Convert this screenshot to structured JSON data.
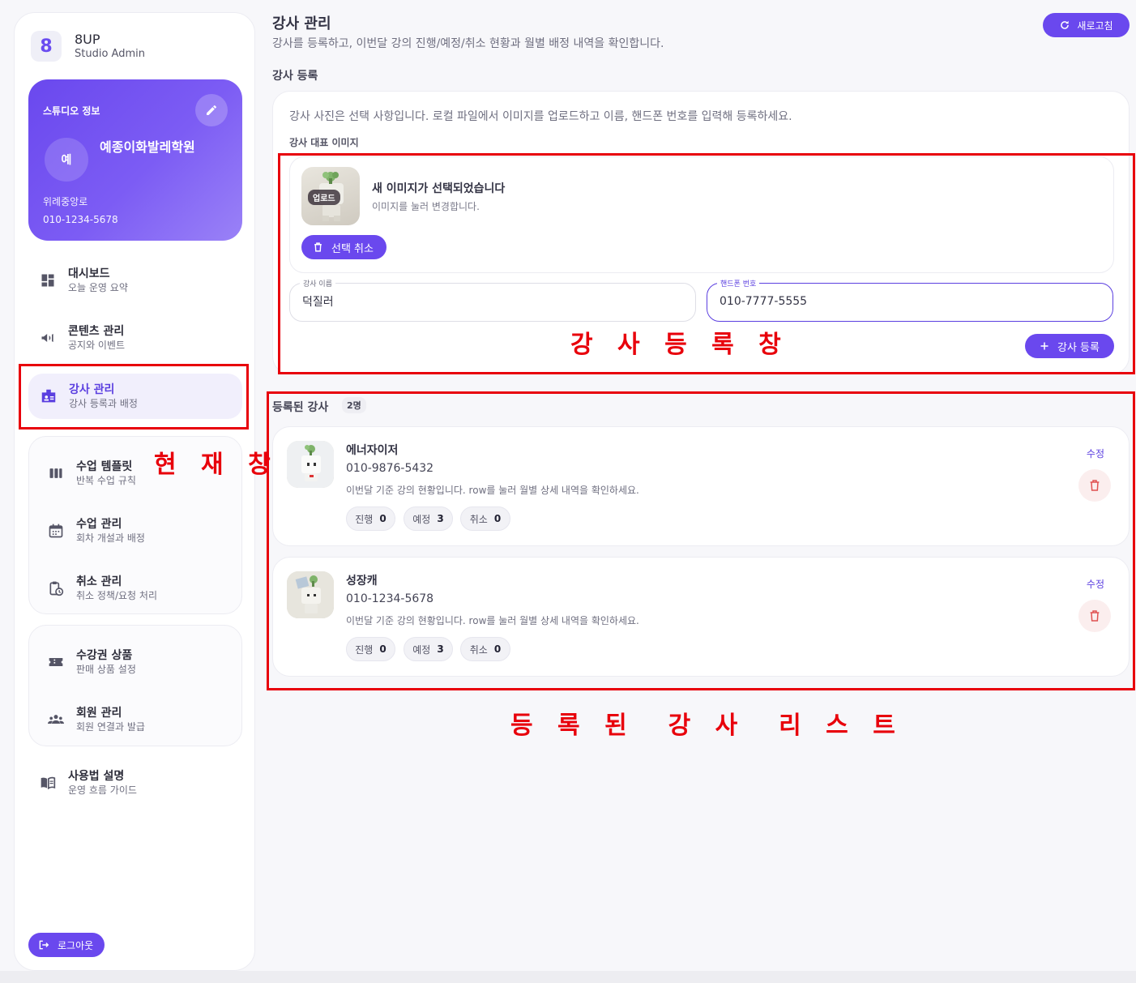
{
  "brand": {
    "name": "8UP",
    "subtitle": "Studio Admin",
    "logo_text": "8"
  },
  "studio": {
    "section_title": "스튜디오 정보",
    "avatar_initial": "예",
    "name": "예종이화발레학원",
    "address": "위례중앙로",
    "phone": "010-1234-5678"
  },
  "nav": {
    "dashboard": {
      "label": "대시보드",
      "sub": "오늘 운영 요약"
    },
    "content": {
      "label": "콘텐츠 관리",
      "sub": "공지와 이벤트"
    },
    "instructors": {
      "label": "강사 관리",
      "sub": "강사 등록과 배정"
    },
    "templates": {
      "label": "수업 템플릿",
      "sub": "반복 수업 규칙"
    },
    "classes": {
      "label": "수업 관리",
      "sub": "회차 개설과 배정"
    },
    "cancellations": {
      "label": "취소 관리",
      "sub": "취소 정책/요청 처리"
    },
    "passes": {
      "label": "수강권 상품",
      "sub": "판매 상품 설정"
    },
    "members": {
      "label": "회원 관리",
      "sub": "회원 연결과 발급"
    },
    "guide": {
      "label": "사용법 설명",
      "sub": "운영 흐름 가이드"
    },
    "logout": "로그아웃"
  },
  "header": {
    "title": "강사 관리",
    "description": "강사를 등록하고, 이번달 강의 진행/예정/취소 현황과 월별 배정 내역을 확인합니다.",
    "refresh": "새로고침"
  },
  "register": {
    "section_title": "강사 등록",
    "guide": "강사 사진은 선택 사항입니다. 로컬 파일에서 이미지를 업로드하고 이름, 핸드폰 번호를 입력해 등록하세요.",
    "image_label": "강사 대표 이미지",
    "upload_tag": "업로드",
    "image_status": "새 이미지가 선택되었습니다",
    "image_hint": "이미지를 눌러 변경합니다.",
    "cancel_selection": "선택 취소",
    "name_label": "강사 이름",
    "name_value": "덕질러",
    "phone_label": "핸드폰 번호",
    "phone_value": "010-7777-5555",
    "submit": "강사 등록"
  },
  "list": {
    "title": "등록된 강사",
    "count": "2명",
    "edit_label": "수정",
    "instructors": [
      {
        "name": "에너자이저",
        "phone": "010-9876-5432",
        "desc": "이번달 기준 강의 현황입니다. row를 눌러 월별 상세 내역을 확인하세요.",
        "stats": [
          {
            "label": "진행",
            "value": "0"
          },
          {
            "label": "예정",
            "value": "3"
          },
          {
            "label": "취소",
            "value": "0"
          }
        ]
      },
      {
        "name": "성장캐",
        "phone": "010-1234-5678",
        "desc": "이번달 기준 강의 현황입니다. row를 눌러 월별 상세 내역을 확인하세요.",
        "stats": [
          {
            "label": "진행",
            "value": "0"
          },
          {
            "label": "예정",
            "value": "3"
          },
          {
            "label": "취소",
            "value": "0"
          }
        ]
      }
    ]
  },
  "annotations": {
    "current_window": "현 재 창",
    "register_window": "강 사 등 록 창",
    "registered_list": "등 록 된  강 사  리 스 트"
  },
  "colors": {
    "accent": "#6a48ee",
    "annotation": "#e8000b",
    "delete_bg": "#fbeeee",
    "delete_icon": "#e05050"
  }
}
